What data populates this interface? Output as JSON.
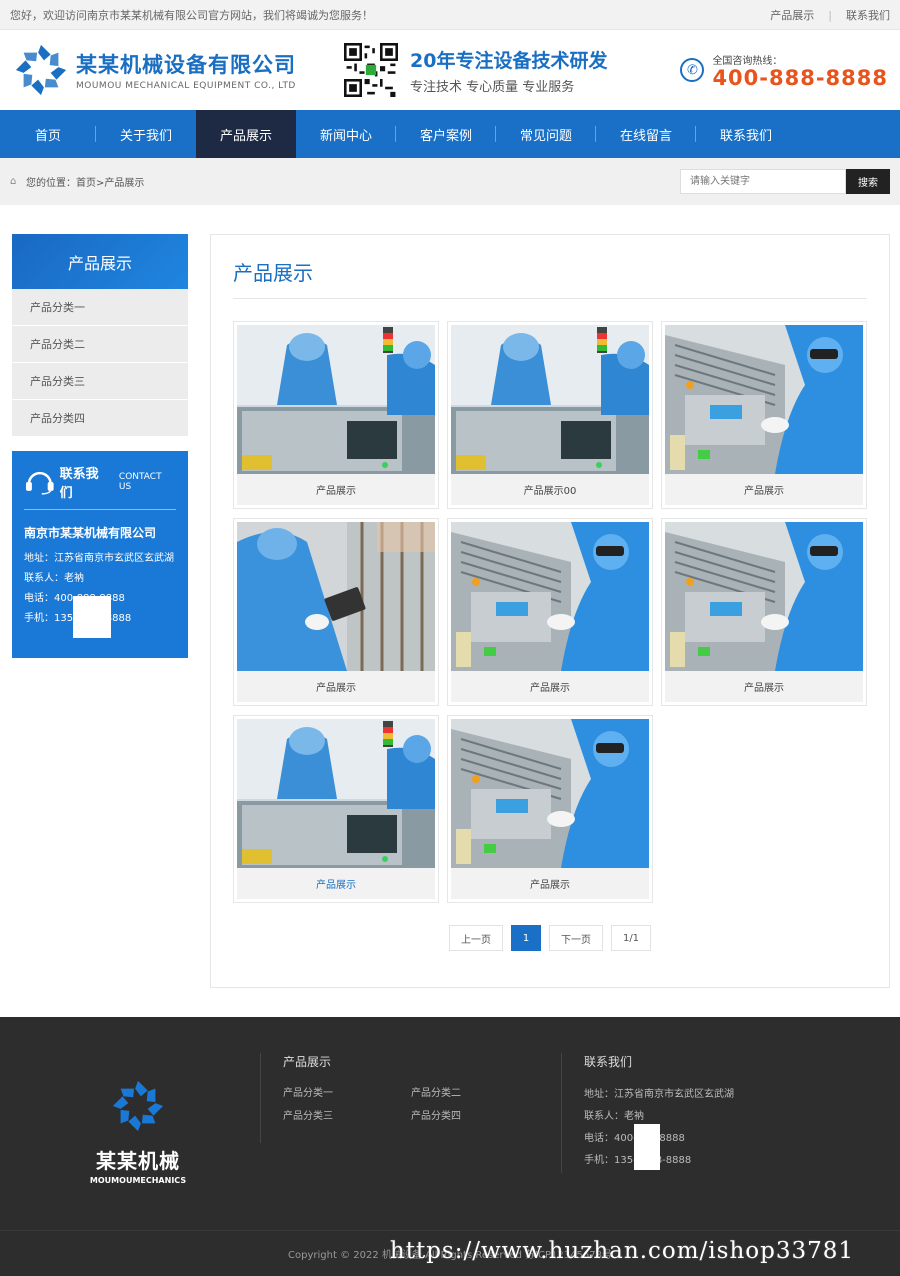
{
  "topbar": {
    "welcome": "您好，欢迎访问南京市某某机械有限公司官方网站，我们将竭诚为您服务！",
    "links": [
      "产品展示",
      "联系我们"
    ],
    "sep": "|"
  },
  "header": {
    "company_cn": "某某机械设备有限公司",
    "company_en": "MOUMOU MECHANICAL EQUIPMENT CO., LTD",
    "slogan_big": "20年专注设备技术研发",
    "slogan_small": "专注技术 专心质量 专业服务",
    "hotline_label": "全国咨询热线：",
    "hotline_number": "400-888-8888",
    "brand_color": "#1a6fc2",
    "hotline_color": "#e8541c"
  },
  "nav": {
    "items": [
      "首页",
      "关于我们",
      "产品展示",
      "新闻中心",
      "客户案例",
      "常见问题",
      "在线留言",
      "联系我们"
    ],
    "active_index": 2
  },
  "breadcrumb": {
    "prefix": "您的位置：",
    "path": "首页>产品展示",
    "search_placeholder": "请输入关键字",
    "search_button": "搜索"
  },
  "sidebar": {
    "title": "产品展示",
    "items": [
      "产品分类一",
      "产品分类二",
      "产品分类三",
      "产品分类四"
    ],
    "contact": {
      "title_cn": "联系我们",
      "title_en": "CONTACT US",
      "company": "南京市某某机械有限公司",
      "address": "地址：江苏省南京市玄武区玄武湖",
      "contact_person": "联系人：老衲",
      "phone": "电话：400-888-8888",
      "mobile": "手机：135-8888-8888"
    }
  },
  "content": {
    "title": "产品展示",
    "products": [
      {
        "caption": "产品展示",
        "icon": "lab-worker-photo"
      },
      {
        "caption": "产品展示00",
        "icon": "lab-worker-photo"
      },
      {
        "caption": "产品展示",
        "icon": "machine-panel-photo"
      },
      {
        "caption": "产品展示",
        "icon": "tablet-worker-photo"
      },
      {
        "caption": "产品展示",
        "icon": "machine-panel-photo"
      },
      {
        "caption": "产品展示",
        "icon": "machine-panel-photo"
      },
      {
        "caption": "产品展示",
        "icon": "lab-worker-photo"
      },
      {
        "caption": "产品展示",
        "icon": "machine-panel-photo"
      }
    ],
    "pager": {
      "prev": "上一页",
      "current": "1",
      "next": "下一页",
      "total": "1/1"
    }
  },
  "footer": {
    "logo_cn": "某某机械",
    "logo_en": "MOUMOUMECHANICS",
    "products_title": "产品展示",
    "categories": [
      "产品分类一",
      "产品分类二",
      "产品分类三",
      "产品分类四"
    ],
    "contact_title": "联系我们",
    "address": "地址：江苏省南京市玄武区玄武湖",
    "contact_person": "联系人：老衲",
    "phone": "电话：400-888-8888",
    "mobile": "手机：135-8888-8888",
    "copyright": "Copyright © 2022 机械设备 All Rights Reserved 苏ICP12345678号",
    "watermark": "https://www.huzhan.com/ishop33781"
  }
}
